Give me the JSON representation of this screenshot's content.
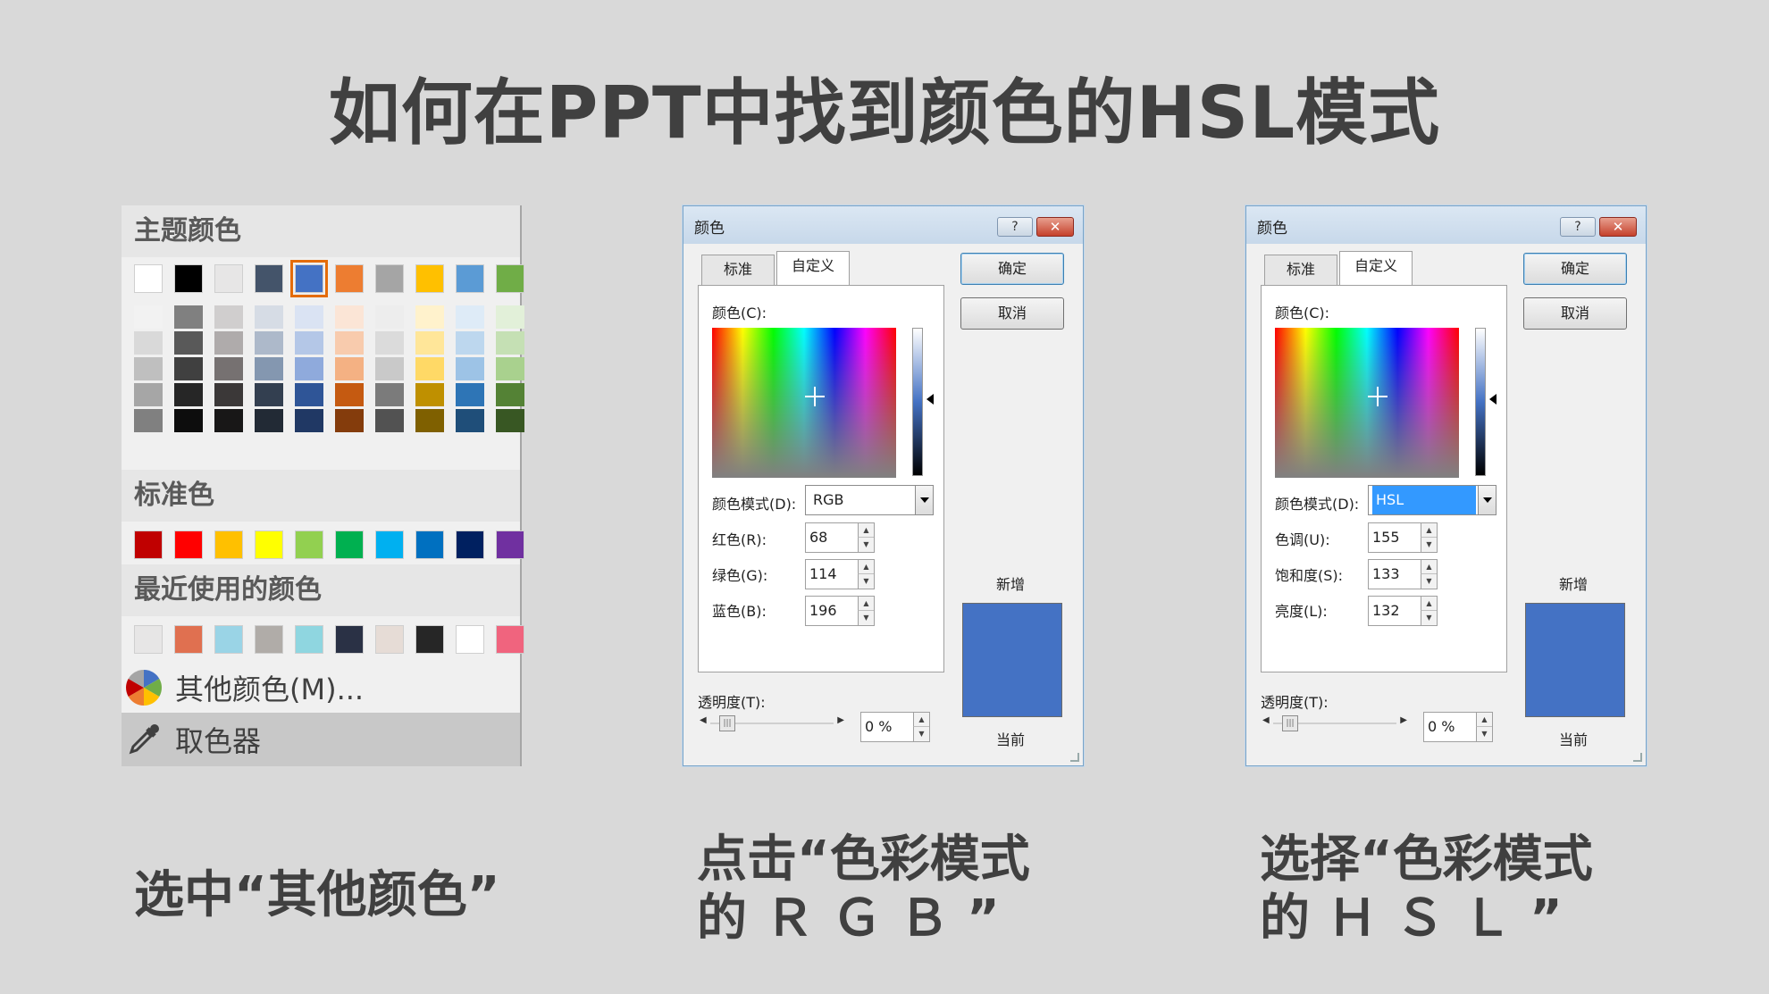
{
  "title": "如何在PPT中找到颜色的HSL模式",
  "menu": {
    "theme_heading": "主题颜色",
    "theme_colors": [
      "#ffffff",
      "#000000",
      "#e7e6e6",
      "#44546a",
      "#4472c4",
      "#ed7d31",
      "#a5a5a5",
      "#ffc000",
      "#5b9bd5",
      "#70ad47"
    ],
    "theme_shades": [
      [
        "#f2f2f2",
        "#d9d9d9",
        "#bfbfbf",
        "#a6a6a6",
        "#808080"
      ],
      [
        "#808080",
        "#595959",
        "#404040",
        "#262626",
        "#0d0d0d"
      ],
      [
        "#d0cece",
        "#afabab",
        "#767171",
        "#3b3838",
        "#181717"
      ],
      [
        "#d6dce5",
        "#adb9ca",
        "#8497b0",
        "#333f50",
        "#222a35"
      ],
      [
        "#dae3f3",
        "#b4c7e7",
        "#8faadc",
        "#2f5597",
        "#203864"
      ],
      [
        "#fbe5d6",
        "#f8cbad",
        "#f4b183",
        "#c55a11",
        "#843c0c"
      ],
      [
        "#ededed",
        "#dbdbdb",
        "#c9c9c9",
        "#7b7b7b",
        "#525252"
      ],
      [
        "#fff2cc",
        "#ffe699",
        "#ffd966",
        "#bf9000",
        "#7f6000"
      ],
      [
        "#deebf7",
        "#bdd7ee",
        "#9dc3e6",
        "#2e75b6",
        "#1f4e79"
      ],
      [
        "#e2f0d9",
        "#c5e0b4",
        "#a9d18e",
        "#548235",
        "#385723"
      ]
    ],
    "standard_heading": "标准色",
    "standard_colors": [
      "#c00000",
      "#ff0000",
      "#ffc000",
      "#ffff00",
      "#92d050",
      "#00b050",
      "#00b0f0",
      "#0070c0",
      "#002060",
      "#7030a0"
    ],
    "recent_heading": "最近使用的颜色",
    "recent_colors": [
      "#e7e6e6",
      "#e07050",
      "#9ad4e6",
      "#b0aca8",
      "#8fd6e0",
      "#2a3145",
      "#e6dcd6",
      "#262626",
      "#ffffff",
      "#f0647e"
    ],
    "more_colors_label": "其他颜色(M)...",
    "eyedropper_label": "取色器"
  },
  "dialog_rgb": {
    "title": "颜色",
    "help": "?",
    "close": "✕",
    "tab_standard": "标准",
    "tab_custom": "自定义",
    "ok": "确定",
    "cancel": "取消",
    "colors_label": "颜色(C):",
    "mode_label": "颜色模式(D):",
    "mode_value": "RGB",
    "field1_label": "红色(R):",
    "field1_value": "68",
    "field2_label": "绿色(G):",
    "field2_value": "114",
    "field3_label": "蓝色(B):",
    "field3_value": "196",
    "new_label": "新增",
    "current_label": "当前",
    "transparency_label": "透明度(T):",
    "transparency_value": "0 %",
    "preview_color": "#4472c4"
  },
  "dialog_hsl": {
    "title": "颜色",
    "help": "?",
    "close": "✕",
    "tab_standard": "标准",
    "tab_custom": "自定义",
    "ok": "确定",
    "cancel": "取消",
    "colors_label": "颜色(C):",
    "mode_label": "颜色模式(D):",
    "mode_value": "HSL",
    "field1_label": "色调(U):",
    "field1_value": "155",
    "field2_label": "饱和度(S):",
    "field2_value": "133",
    "field3_label": "亮度(L):",
    "field3_value": "132",
    "new_label": "新增",
    "current_label": "当前",
    "transparency_label": "透明度(T):",
    "transparency_value": "0 %",
    "preview_color": "#4472c4"
  },
  "captions": {
    "left": "选中“其他颜色”",
    "middle_line1": "点击“色彩模式",
    "middle_line2": "的 Ｒ Ｇ Ｂ ”",
    "right_line1": "选择“色彩模式",
    "right_line2": "的 Ｈ Ｓ Ｌ ”"
  }
}
